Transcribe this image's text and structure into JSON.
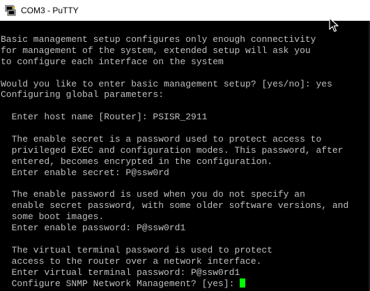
{
  "window": {
    "title": "COM3 - PuTTY",
    "app_icon": "putty-icon"
  },
  "terminal": {
    "lines": [
      "Basic management setup configures only enough connectivity",
      "for management of the system, extended setup will ask you",
      "to configure each interface on the system",
      "",
      "Would you like to enter basic management setup? [yes/no]: yes",
      "Configuring global parameters:",
      "",
      "  Enter host name [Router]: PSISR_2911",
      "",
      "  The enable secret is a password used to protect access to",
      "  privileged EXEC and configuration modes. This password, after",
      "  entered, becomes encrypted in the configuration.",
      "  Enter enable secret: P@ssw0rd",
      "",
      "  The enable password is used when you do not specify an",
      "  enable secret password, with some older software versions, and",
      "  some boot images.",
      "  Enter enable password: P@ssw0rd1",
      "",
      "  The virtual terminal password is used to protect",
      "  access to the router over a network interface.",
      "  Enter virtual terminal password: P@ssw0rd1",
      "  Configure SNMP Network Management? [yes]: "
    ],
    "text_color": "#c0c0c0",
    "background_color": "#000000",
    "cursor_color": "#00ff00"
  }
}
